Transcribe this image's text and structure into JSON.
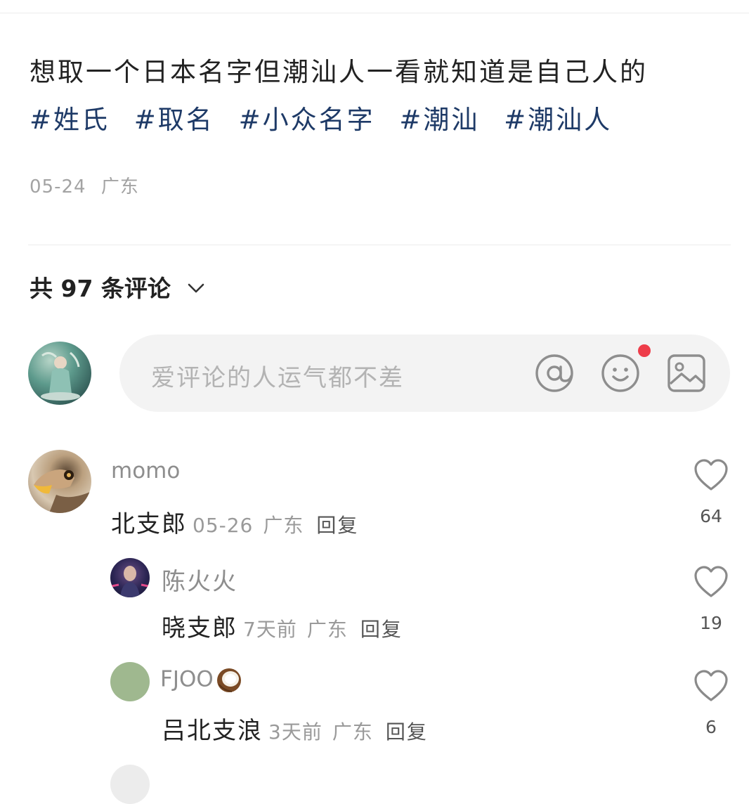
{
  "post": {
    "text": "想取一个日本名字但潮汕人一看就知道是自己人的",
    "tags": [
      "#姓氏",
      "#取名",
      "#小众名字",
      "#潮汕",
      "#潮汕人"
    ],
    "date": "05-24",
    "location": "广东"
  },
  "comments_header": {
    "count_label": "共 97 条评论"
  },
  "composer": {
    "placeholder": "爱评论的人运气都不差",
    "icons": [
      "at-icon",
      "emoji-icon",
      "image-icon"
    ],
    "notification_dot_color": "#ee3d4a"
  },
  "colors": {
    "tag": "#1e3a67",
    "text": "#222222",
    "muted": "#9a9a9a"
  },
  "comments": [
    {
      "username": "momo",
      "text": "北支郎",
      "date": "05-26",
      "location": "广东",
      "reply_label": "回复",
      "likes": "64",
      "replies": [
        {
          "username": "陈火火",
          "text": "晓支郎",
          "date": "7天前",
          "location": "广东",
          "reply_label": "回复",
          "likes": "19"
        },
        {
          "username": "FJOO",
          "username_emoji": "coconut-icon",
          "text": "吕北支浪",
          "date": "3天前",
          "location": "广东",
          "reply_label": "回复",
          "likes": "6"
        },
        {
          "username": " "
        }
      ]
    }
  ]
}
